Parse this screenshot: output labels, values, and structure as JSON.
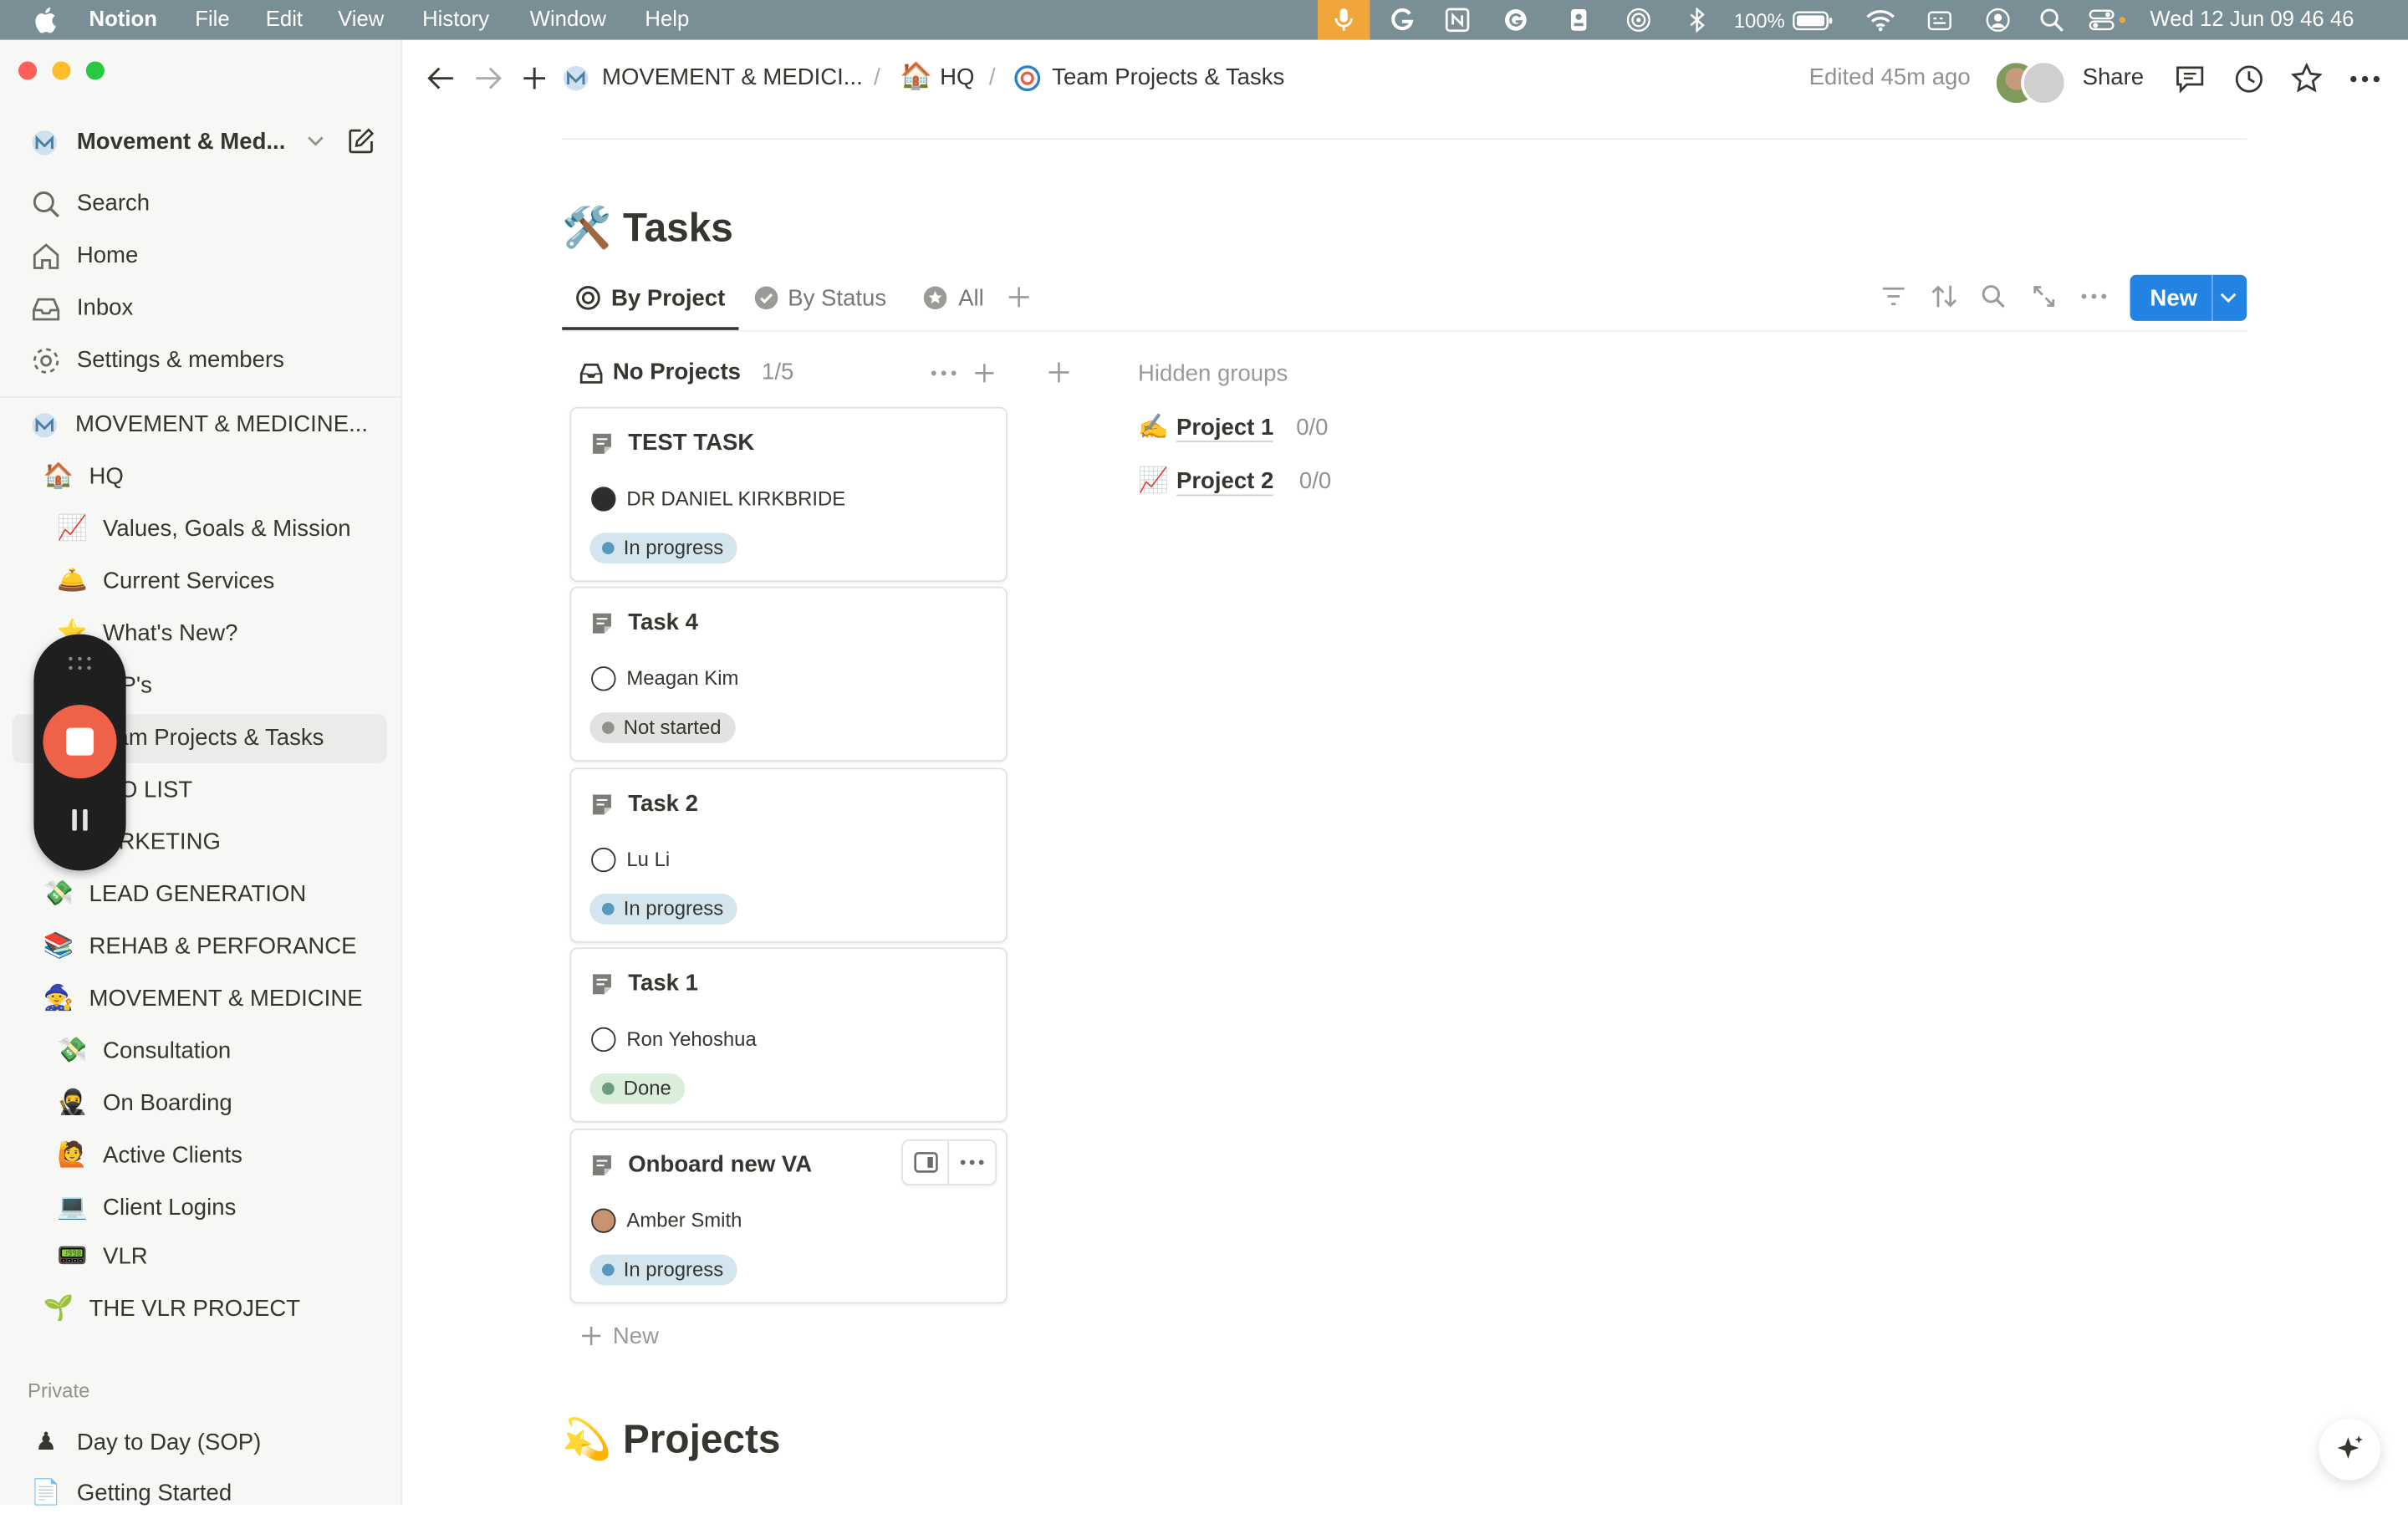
{
  "menubar": {
    "app_name": "Notion",
    "menus": [
      "File",
      "Edit",
      "View",
      "History",
      "Window",
      "Help"
    ],
    "battery": "100%",
    "datetime": "Wed 12 Jun  09 46 46"
  },
  "sidebar": {
    "workspace_name": "Movement & Med...",
    "nav": {
      "search": "Search",
      "home": "Home",
      "inbox": "Inbox",
      "settings": "Settings & members"
    },
    "teamspace": "MOVEMENT & MEDICINE...",
    "items": [
      {
        "icon": "🏠",
        "label": "HQ"
      },
      {
        "icon": "📈",
        "label": "Values, Goals & Mission"
      },
      {
        "icon": "🛎️",
        "label": "Current Services"
      },
      {
        "icon": "⭐",
        "label": "What's New?"
      },
      {
        "icon": "📄",
        "label": "OP's"
      },
      {
        "icon": "🎯",
        "label": "eam Projects & Tasks"
      },
      {
        "icon": "✅",
        "label": "DO LIST"
      },
      {
        "icon": "📣",
        "label": "ARKETING"
      },
      {
        "icon": "💸",
        "label": "LEAD GENERATION"
      },
      {
        "icon": "📚",
        "label": "REHAB & PERFORANCE"
      },
      {
        "icon": "🧙",
        "label": "MOVEMENT & MEDICINE"
      },
      {
        "icon": "💸",
        "label": "Consultation"
      },
      {
        "icon": "🥷",
        "label": "On Boarding"
      },
      {
        "icon": "🙋",
        "label": "Active Clients"
      },
      {
        "icon": "💻",
        "label": "Client Logins"
      },
      {
        "icon": "📟",
        "label": "VLR"
      },
      {
        "icon": "🌱",
        "label": "THE VLR PROJECT"
      }
    ],
    "private_header": "Private",
    "private_items": [
      {
        "icon": "♟",
        "label": "Day to Day (SOP)"
      },
      {
        "icon": "📄",
        "label": "Getting Started"
      }
    ]
  },
  "topbar": {
    "breadcrumb": [
      "MOVEMENT & MEDICI...",
      "HQ",
      "Team Projects & Tasks"
    ],
    "breadcrumb_sep": "/",
    "edited": "Edited 45m ago",
    "share": "Share"
  },
  "page": {
    "title_icon": "🛠️",
    "title": "Tasks",
    "tabs": [
      "By Project",
      "By Status",
      "All"
    ],
    "new_button": "New",
    "group": {
      "name": "No Projects",
      "count": "1/5"
    },
    "hidden_groups_label": "Hidden groups",
    "hidden_groups": [
      {
        "icon": "✍️",
        "name": "Project 1",
        "count": "0/0"
      },
      {
        "icon": "📈",
        "name": "Project 2",
        "count": "0/0"
      }
    ],
    "cards": [
      {
        "title": "TEST TASK",
        "person": "DR DANIEL KIRKBRIDE",
        "status": "In progress"
      },
      {
        "title": "Task 4",
        "person": "Meagan Kim",
        "status": "Not started"
      },
      {
        "title": "Task 2",
        "person": "Lu Li",
        "status": "In progress"
      },
      {
        "title": "Task 1",
        "person": "Ron Yehoshua",
        "status": "Done"
      },
      {
        "title": "Onboard new VA",
        "person": "Amber Smith",
        "status": "In progress"
      }
    ],
    "add_new": "New",
    "projects_icon": "💫",
    "projects_title": "Projects"
  },
  "colors": {
    "accent": "#2383e2",
    "in_progress_bg": "#d3e5ef",
    "in_progress_dot": "#5b97bd",
    "not_started_bg": "#e3e2e0",
    "not_started_dot": "#91918e",
    "done_bg": "#dbeddb",
    "done_dot": "#6c9b7d"
  }
}
